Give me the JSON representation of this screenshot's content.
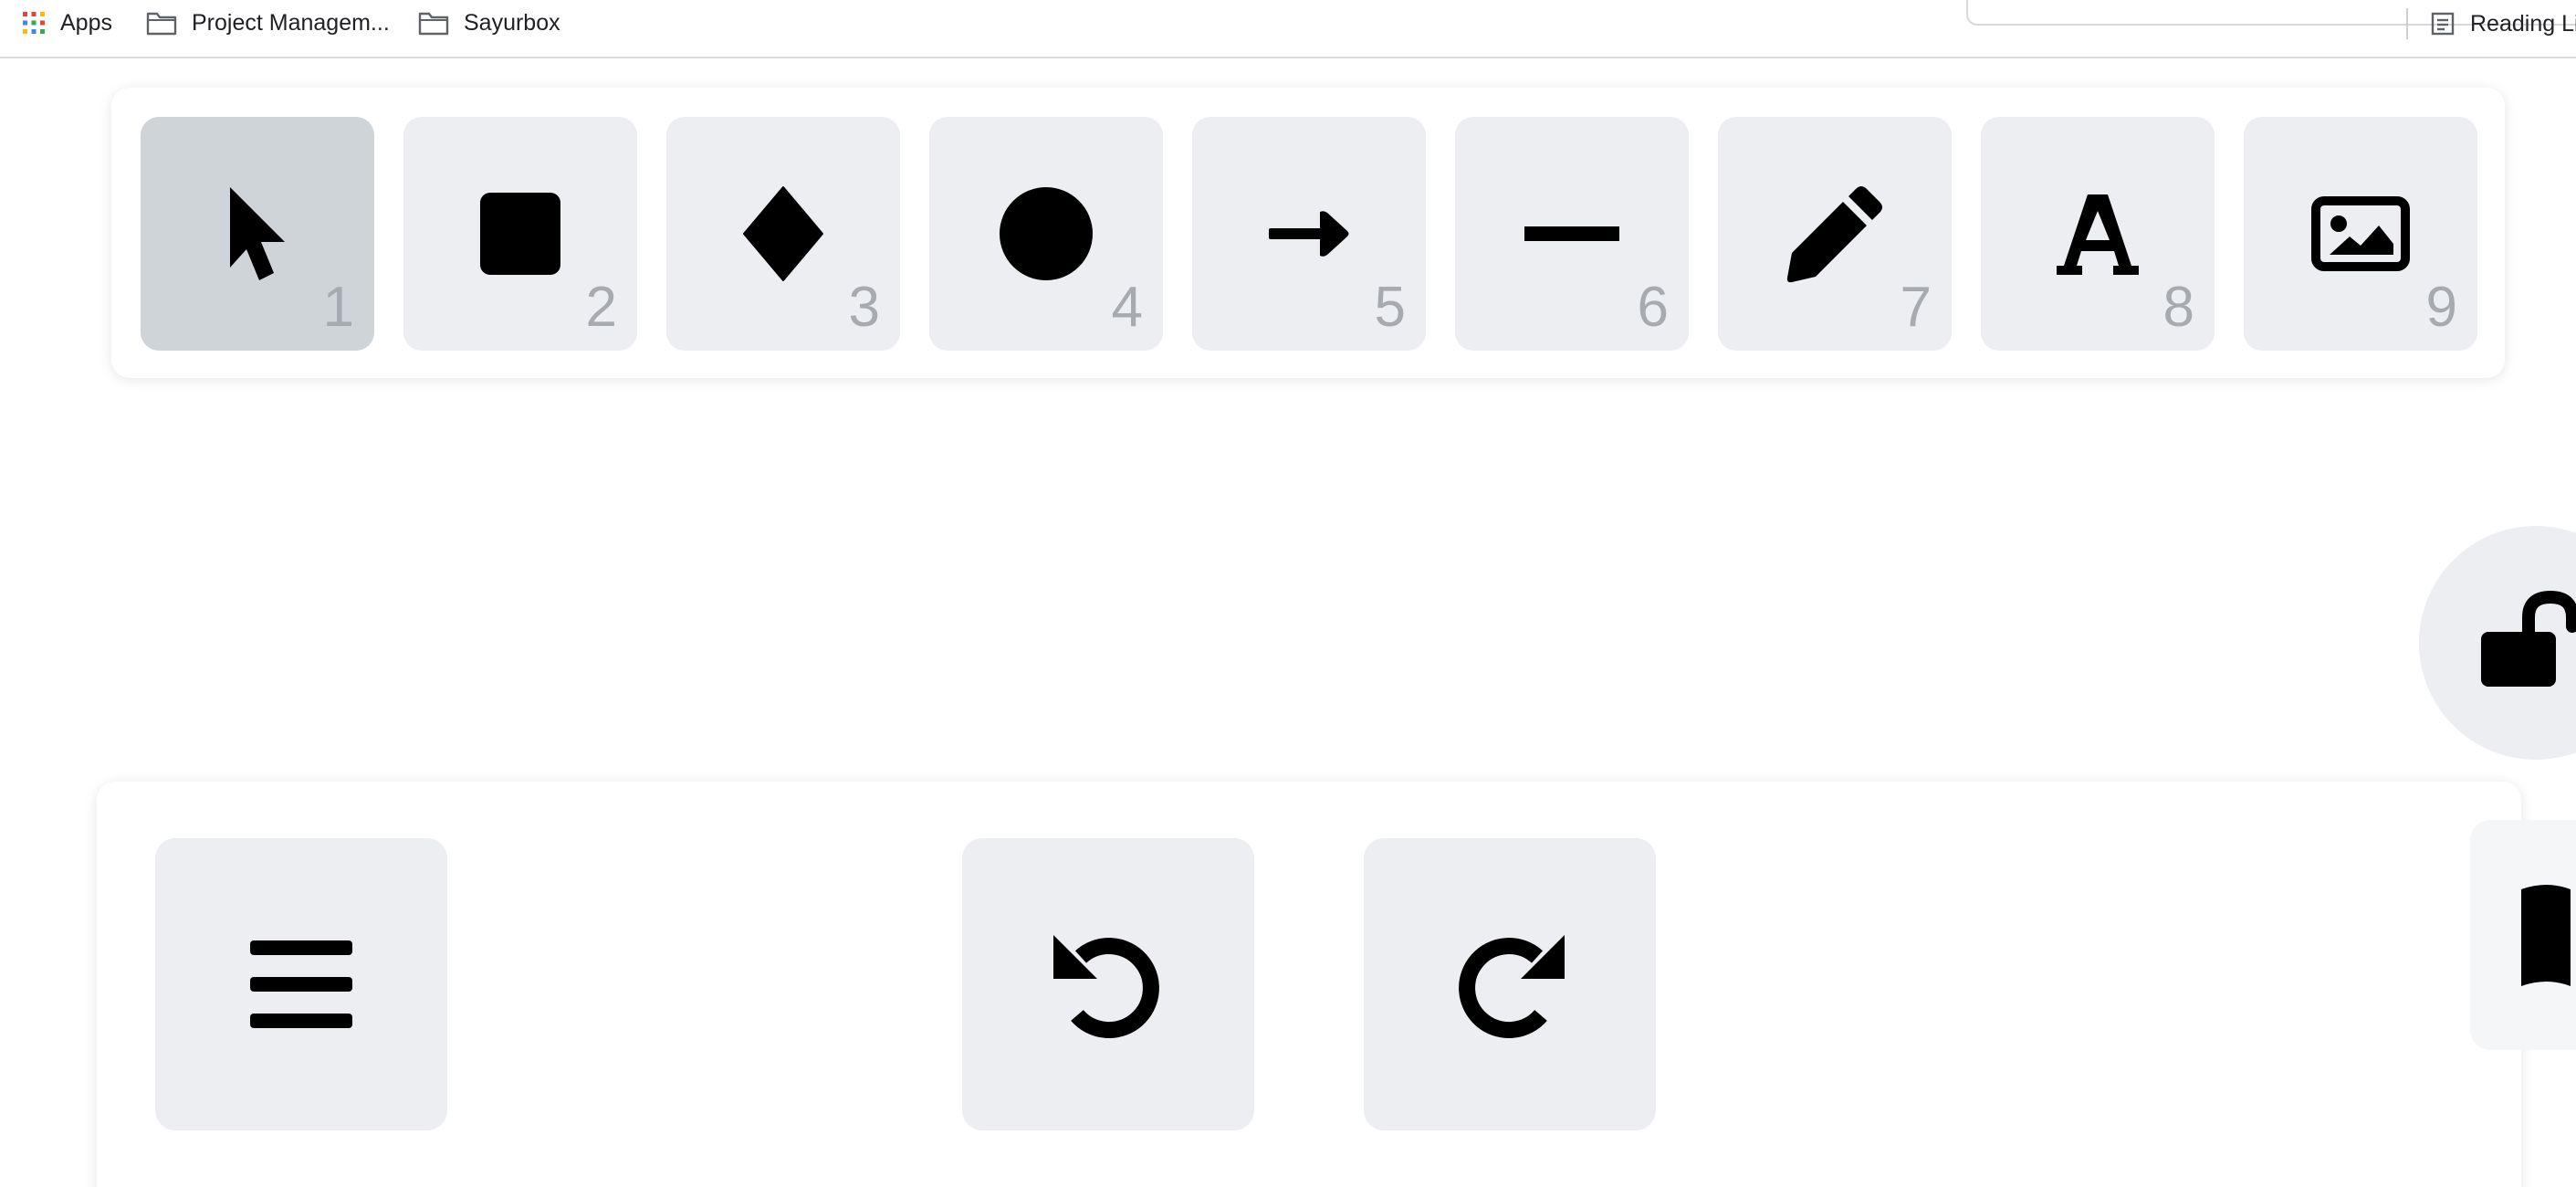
{
  "bookmarks": {
    "apps_label": "Apps",
    "items": [
      {
        "label": "Project Managem...",
        "icon": "folder-icon"
      },
      {
        "label": "Sayurbox",
        "icon": "folder-icon"
      }
    ],
    "reading_list_label": "Reading Li"
  },
  "toolbar": {
    "selected_index": 0,
    "tools": [
      {
        "key": "1",
        "icon": "cursor-icon",
        "label": "Selection"
      },
      {
        "key": "2",
        "icon": "square-icon",
        "label": "Rectangle"
      },
      {
        "key": "3",
        "icon": "diamond-icon",
        "label": "Diamond"
      },
      {
        "key": "4",
        "icon": "circle-icon",
        "label": "Ellipse"
      },
      {
        "key": "5",
        "icon": "arrow-right-icon",
        "label": "Arrow"
      },
      {
        "key": "6",
        "icon": "line-icon",
        "label": "Line"
      },
      {
        "key": "7",
        "icon": "pencil-icon",
        "label": "Draw"
      },
      {
        "key": "8",
        "icon": "text-icon",
        "label": "Text"
      },
      {
        "key": "9",
        "icon": "image-icon",
        "label": "Insert image"
      }
    ]
  },
  "side": {
    "lock_icon": "lock-open-icon",
    "library_icon": "book-open-icon"
  },
  "bottom": {
    "menu_icon": "hamburger-menu-icon",
    "undo_icon": "undo-icon",
    "redo_icon": "redo-icon"
  },
  "colors": {
    "tool_bg": "#eceef1",
    "tool_selected_bg": "#cfd4d9",
    "shortcut_text": "#a7abb0",
    "icon": "#000000"
  }
}
